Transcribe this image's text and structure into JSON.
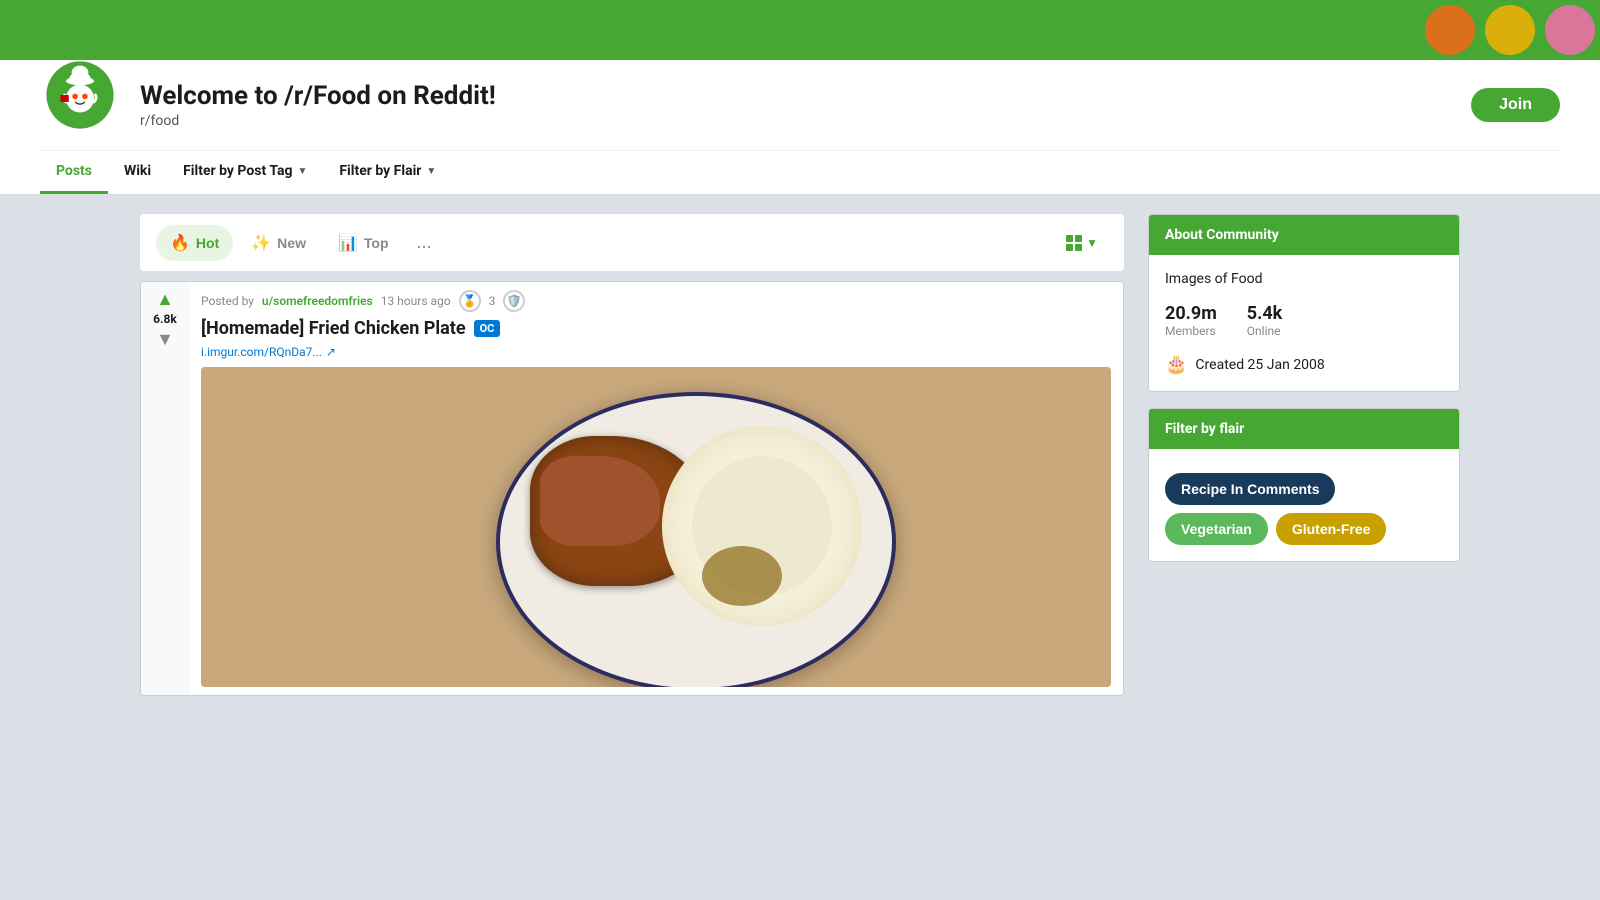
{
  "header": {
    "banner_bg": "#46a832",
    "title": "Welcome to /r/Food on Reddit!",
    "subreddit": "r/food",
    "join_label": "Join"
  },
  "nav": {
    "items": [
      {
        "id": "posts",
        "label": "Posts",
        "active": true,
        "has_arrow": false
      },
      {
        "id": "wiki",
        "label": "Wiki",
        "active": false,
        "has_arrow": false
      },
      {
        "id": "filter-tag",
        "label": "Filter by Post Tag",
        "active": false,
        "has_arrow": true
      },
      {
        "id": "filter-flair",
        "label": "Filter by Flair",
        "active": false,
        "has_arrow": true
      }
    ]
  },
  "sort": {
    "hot_label": "Hot",
    "new_label": "New",
    "top_label": "Top",
    "more": "...",
    "active": "hot"
  },
  "post": {
    "meta": {
      "prefix": "Posted by",
      "user": "u/somefreedomfries",
      "time": "13 hours ago",
      "award_count": "3"
    },
    "title": "[Homemade] Fried Chicken Plate",
    "oc_badge": "OC",
    "link_text": "i.imgur.com/RQnDa7...",
    "vote_count": "6.8k",
    "vote_count_display": "6.8k"
  },
  "sidebar": {
    "about": {
      "header": "About Community",
      "description": "Images of Food",
      "members_value": "20.9m",
      "members_label": "Members",
      "online_value": "5.4k",
      "online_label": "Online",
      "created_label": "Created 25 Jan 2008"
    },
    "filter_flair": {
      "header": "Filter by flair",
      "tags": [
        {
          "id": "recipe-in-comments",
          "label": "Recipe In Comments",
          "style": "blue"
        },
        {
          "id": "vegetarian",
          "label": "Vegetarian",
          "style": "green"
        },
        {
          "id": "gluten-free",
          "label": "Gluten-Free",
          "style": "gold"
        }
      ]
    }
  }
}
